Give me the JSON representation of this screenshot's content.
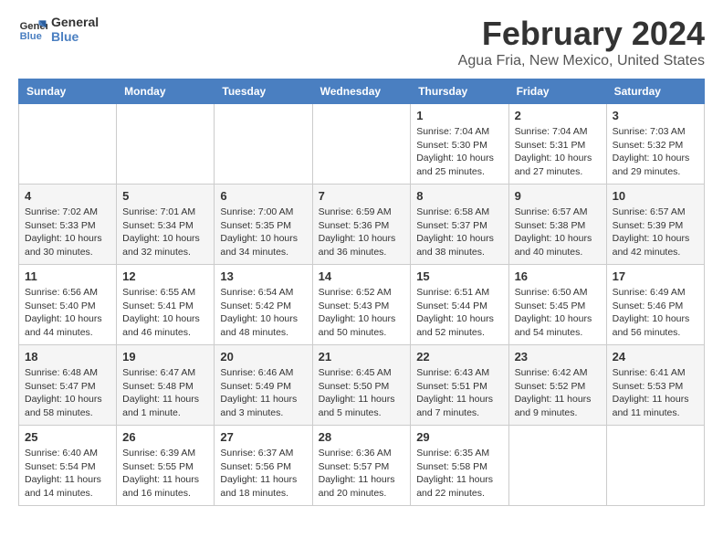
{
  "logo": {
    "line1": "General",
    "line2": "Blue"
  },
  "title": "February 2024",
  "subtitle": "Agua Fria, New Mexico, United States",
  "days_of_week": [
    "Sunday",
    "Monday",
    "Tuesday",
    "Wednesday",
    "Thursday",
    "Friday",
    "Saturday"
  ],
  "weeks": [
    [
      {
        "day": "",
        "info": ""
      },
      {
        "day": "",
        "info": ""
      },
      {
        "day": "",
        "info": ""
      },
      {
        "day": "",
        "info": ""
      },
      {
        "day": "1",
        "info": "Sunrise: 7:04 AM\nSunset: 5:30 PM\nDaylight: 10 hours\nand 25 minutes."
      },
      {
        "day": "2",
        "info": "Sunrise: 7:04 AM\nSunset: 5:31 PM\nDaylight: 10 hours\nand 27 minutes."
      },
      {
        "day": "3",
        "info": "Sunrise: 7:03 AM\nSunset: 5:32 PM\nDaylight: 10 hours\nand 29 minutes."
      }
    ],
    [
      {
        "day": "4",
        "info": "Sunrise: 7:02 AM\nSunset: 5:33 PM\nDaylight: 10 hours\nand 30 minutes."
      },
      {
        "day": "5",
        "info": "Sunrise: 7:01 AM\nSunset: 5:34 PM\nDaylight: 10 hours\nand 32 minutes."
      },
      {
        "day": "6",
        "info": "Sunrise: 7:00 AM\nSunset: 5:35 PM\nDaylight: 10 hours\nand 34 minutes."
      },
      {
        "day": "7",
        "info": "Sunrise: 6:59 AM\nSunset: 5:36 PM\nDaylight: 10 hours\nand 36 minutes."
      },
      {
        "day": "8",
        "info": "Sunrise: 6:58 AM\nSunset: 5:37 PM\nDaylight: 10 hours\nand 38 minutes."
      },
      {
        "day": "9",
        "info": "Sunrise: 6:57 AM\nSunset: 5:38 PM\nDaylight: 10 hours\nand 40 minutes."
      },
      {
        "day": "10",
        "info": "Sunrise: 6:57 AM\nSunset: 5:39 PM\nDaylight: 10 hours\nand 42 minutes."
      }
    ],
    [
      {
        "day": "11",
        "info": "Sunrise: 6:56 AM\nSunset: 5:40 PM\nDaylight: 10 hours\nand 44 minutes."
      },
      {
        "day": "12",
        "info": "Sunrise: 6:55 AM\nSunset: 5:41 PM\nDaylight: 10 hours\nand 46 minutes."
      },
      {
        "day": "13",
        "info": "Sunrise: 6:54 AM\nSunset: 5:42 PM\nDaylight: 10 hours\nand 48 minutes."
      },
      {
        "day": "14",
        "info": "Sunrise: 6:52 AM\nSunset: 5:43 PM\nDaylight: 10 hours\nand 50 minutes."
      },
      {
        "day": "15",
        "info": "Sunrise: 6:51 AM\nSunset: 5:44 PM\nDaylight: 10 hours\nand 52 minutes."
      },
      {
        "day": "16",
        "info": "Sunrise: 6:50 AM\nSunset: 5:45 PM\nDaylight: 10 hours\nand 54 minutes."
      },
      {
        "day": "17",
        "info": "Sunrise: 6:49 AM\nSunset: 5:46 PM\nDaylight: 10 hours\nand 56 minutes."
      }
    ],
    [
      {
        "day": "18",
        "info": "Sunrise: 6:48 AM\nSunset: 5:47 PM\nDaylight: 10 hours\nand 58 minutes."
      },
      {
        "day": "19",
        "info": "Sunrise: 6:47 AM\nSunset: 5:48 PM\nDaylight: 11 hours\nand 1 minute."
      },
      {
        "day": "20",
        "info": "Sunrise: 6:46 AM\nSunset: 5:49 PM\nDaylight: 11 hours\nand 3 minutes."
      },
      {
        "day": "21",
        "info": "Sunrise: 6:45 AM\nSunset: 5:50 PM\nDaylight: 11 hours\nand 5 minutes."
      },
      {
        "day": "22",
        "info": "Sunrise: 6:43 AM\nSunset: 5:51 PM\nDaylight: 11 hours\nand 7 minutes."
      },
      {
        "day": "23",
        "info": "Sunrise: 6:42 AM\nSunset: 5:52 PM\nDaylight: 11 hours\nand 9 minutes."
      },
      {
        "day": "24",
        "info": "Sunrise: 6:41 AM\nSunset: 5:53 PM\nDaylight: 11 hours\nand 11 minutes."
      }
    ],
    [
      {
        "day": "25",
        "info": "Sunrise: 6:40 AM\nSunset: 5:54 PM\nDaylight: 11 hours\nand 14 minutes."
      },
      {
        "day": "26",
        "info": "Sunrise: 6:39 AM\nSunset: 5:55 PM\nDaylight: 11 hours\nand 16 minutes."
      },
      {
        "day": "27",
        "info": "Sunrise: 6:37 AM\nSunset: 5:56 PM\nDaylight: 11 hours\nand 18 minutes."
      },
      {
        "day": "28",
        "info": "Sunrise: 6:36 AM\nSunset: 5:57 PM\nDaylight: 11 hours\nand 20 minutes."
      },
      {
        "day": "29",
        "info": "Sunrise: 6:35 AM\nSunset: 5:58 PM\nDaylight: 11 hours\nand 22 minutes."
      },
      {
        "day": "",
        "info": ""
      },
      {
        "day": "",
        "info": ""
      }
    ]
  ]
}
